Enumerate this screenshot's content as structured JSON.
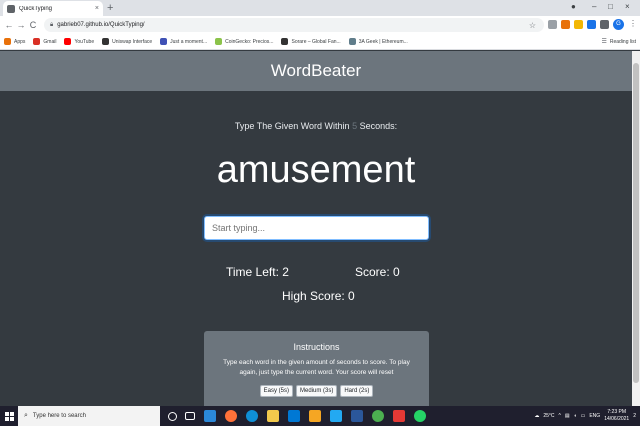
{
  "browser": {
    "tab_title": "QuickTyping",
    "tab_close": "×",
    "new_tab": "+",
    "url": "gabrieb07.github.io/QuickTyping/",
    "back": "←",
    "forward": "→",
    "reload": "C",
    "profile_initial": "G",
    "window_controls": [
      "–",
      "□",
      "×"
    ]
  },
  "bookmarks": {
    "items": [
      {
        "label": "Apps",
        "color": "#e8710a"
      },
      {
        "label": "Gmail",
        "color": "#d93025"
      },
      {
        "label": "YouTube",
        "color": "#ff0000"
      },
      {
        "label": "Uniswap Interface",
        "color": "#333333"
      },
      {
        "label": "Just a moment...",
        "color": "#3f51b5"
      },
      {
        "label": "CoinGecko: Precios...",
        "color": "#8bc34a"
      },
      {
        "label": "Sorare – Global Fan...",
        "color": "#333333"
      },
      {
        "label": "3A Geek | Ethereum...",
        "color": "#607d8b"
      }
    ],
    "reading_list": "Reading list"
  },
  "app": {
    "title": "WordBeater",
    "lead_prefix": "Type The Given Word Within",
    "seconds": "5",
    "lead_suffix": "Seconds:",
    "current_word": "amusement",
    "input_placeholder": "Start typing...",
    "time_left": "Time Left: 2",
    "score": "Score: 0",
    "high_score": "High Score: 0",
    "instructions": {
      "title": "Instructions",
      "text": "Type each word in the given amount of seconds to score. To play again, just type the current word. Your score will reset",
      "buttons": [
        "Easy (5s)",
        "Medium (3s)",
        "Hard (2s)"
      ]
    }
  },
  "taskbar": {
    "search_placeholder": "Type here to search",
    "weather": "25°C",
    "language": "ENG",
    "time": "7:23 PM",
    "date": "14/06/2021",
    "notifications": "2"
  }
}
